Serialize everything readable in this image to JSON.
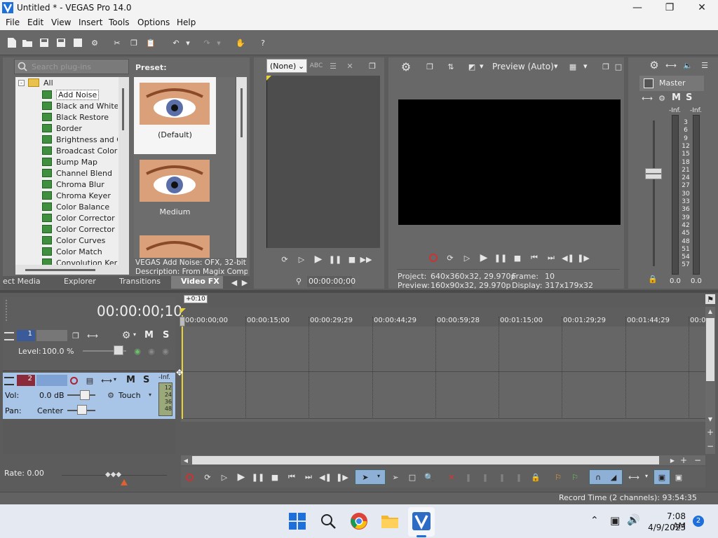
{
  "window": {
    "title": "Untitled * - VEGAS Pro 14.0"
  },
  "menu": [
    "File",
    "Edit",
    "View",
    "Insert",
    "Tools",
    "Options",
    "Help"
  ],
  "plugin_browser": {
    "search_placeholder": "Search plug-ins",
    "root_label": "All",
    "items": [
      "Add Noise",
      "Black and White",
      "Black Restore",
      "Border",
      "Brightness and Co",
      "Broadcast Colors",
      "Bump Map",
      "Channel Blend",
      "Chroma Blur",
      "Chroma Keyer",
      "Color Balance",
      "Color Corrector",
      "Color Corrector (S",
      "Color Curves",
      "Color Match",
      "Convolution Kerne"
    ],
    "preset_label": "Preset:",
    "presets": [
      "(Default)",
      "Medium"
    ],
    "info_line1": "VEGAS Add Noise: OFX, 32-bit flo",
    "info_line2": "Description: From Magix Compute",
    "tabs": [
      "ect Media",
      "Explorer",
      "Transitions",
      "Video FX"
    ]
  },
  "trimmer": {
    "dropdown": "(None)",
    "time": "00:00:00;00"
  },
  "preview": {
    "mode": "Preview (Auto)",
    "project_label": "Project:",
    "project_value": "640x360x32, 29.970p",
    "frame_label": "Frame:",
    "frame_value": "10",
    "preview_label": "Preview:",
    "preview_value": "160x90x32, 29.970p",
    "display_label": "Display:",
    "display_value": "317x179x32"
  },
  "mixer": {
    "master": "Master",
    "m": "M",
    "s": "S",
    "inf_left": "-Inf.",
    "inf_right": "-Inf.",
    "scale": [
      "3",
      "6",
      "9",
      "12",
      "15",
      "18",
      "21",
      "24",
      "27",
      "30",
      "33",
      "36",
      "39",
      "42",
      "45",
      "48",
      "51",
      "54",
      "57"
    ],
    "bottom_left": "0.0",
    "bottom_right": "0.0"
  },
  "timeline": {
    "timecode": "00:00:00;10",
    "cursor_flag": "+0:10",
    "ruler": [
      "00:00:00;00",
      "00:00:15;00",
      "00:00:29;29",
      "00:00:44;29",
      "00:00:59;28",
      "00:01:15;00",
      "00:01:29;29",
      "00:01:44;29",
      "00:0"
    ],
    "track1": {
      "number": "1",
      "level_label": "Level:",
      "level_value": "100.0 %",
      "m": "M",
      "s": "S"
    },
    "track2": {
      "number": "2",
      "vol_label": "Vol:",
      "vol_value": "0.0 dB",
      "pan_label": "Pan:",
      "pan_value": "Center",
      "touch": "Touch",
      "m": "M",
      "s": "S",
      "inf": "-Inf.",
      "meter": [
        "12",
        "24",
        "36",
        "48"
      ]
    },
    "rate": "Rate: 0.00"
  },
  "status": {
    "record_time": "Record Time (2 channels): 93:54:35"
  },
  "taskbar": {
    "time": "7:08 AM",
    "date": "4/9/2023",
    "badge": "2"
  },
  "colors": {
    "accent_blue": "#1e6fd9",
    "track_selected": "#a8c4e6",
    "panel": "#686868"
  }
}
